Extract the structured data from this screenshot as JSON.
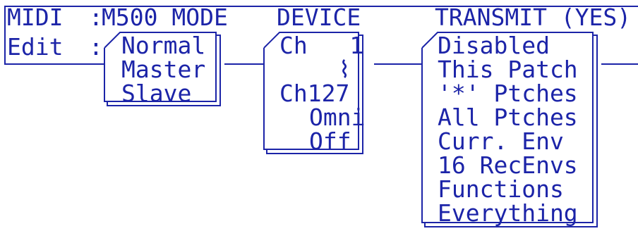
{
  "header": {
    "midi_label": "MIDI",
    "separator": ":",
    "mode_title": "M500 MODE",
    "device_title": "DEVICE",
    "transmit_title": "TRANSMIT (YES)"
  },
  "edit_row": {
    "label": "Edit",
    "separator": ":"
  },
  "mode_menu": {
    "items": [
      "Normal",
      "Master",
      "Slave"
    ]
  },
  "device_menu": {
    "first": "Ch   1",
    "range_glyph": "⌇",
    "last": "Ch127",
    "omni": "Omni",
    "off": "Off"
  },
  "transmit_menu": {
    "items": [
      "Disabled",
      "This Patch",
      "'*' Ptches",
      "All Ptches",
      "Curr. Env",
      "16 RecEnvs",
      "Functions",
      "Everything"
    ]
  },
  "colors": {
    "ink": "#1c24a8",
    "background": "#ffffff"
  }
}
